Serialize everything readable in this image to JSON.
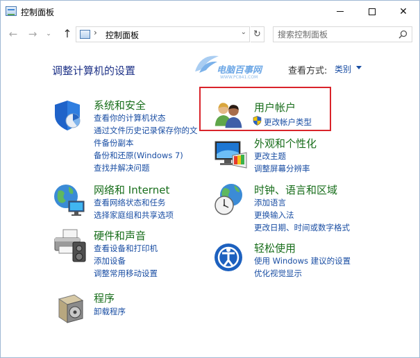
{
  "window": {
    "title": "控制面板",
    "minimize_label": "",
    "maximize_label": "",
    "close_label": "✕"
  },
  "nav": {
    "back": "←",
    "forward": "→",
    "recent": "⌄",
    "up": "↑",
    "address_separator": "›",
    "address": "控制面板",
    "address_dropdown": "⌄",
    "refresh": "↻",
    "search_placeholder": "搜索控制面板"
  },
  "header": {
    "heading": "调整计算机的设置",
    "view_by_label": "查看方式:",
    "view_by_value": "类别"
  },
  "watermark": {
    "title": "电脑百事网",
    "url": "WWW.PC841.COM"
  },
  "categories": {
    "system": {
      "title": "系统和安全",
      "links": [
        "查看你的计算机状态",
        "通过文件历史记录保存你的文",
        "件备份副本",
        "备份和还原(Windows 7)",
        "查找并解决问题"
      ]
    },
    "network": {
      "title": "网络和 Internet",
      "links": [
        "查看网络状态和任务",
        "选择家庭组和共享选项"
      ]
    },
    "hardware": {
      "title": "硬件和声音",
      "links": [
        "查看设备和打印机",
        "添加设备",
        "调整常用移动设置"
      ]
    },
    "programs": {
      "title": "程序",
      "links": [
        "卸载程序"
      ]
    },
    "accounts": {
      "title": "用户帐户",
      "links": [
        "更改帐户类型"
      ]
    },
    "appearance": {
      "title": "外观和个性化",
      "links": [
        "更改主题",
        "调整屏幕分辨率"
      ]
    },
    "clock": {
      "title": "时钟、语言和区域",
      "links": [
        "添加语言",
        "更换输入法",
        "更改日期、时间或数字格式"
      ]
    },
    "ease": {
      "title": "轻松使用",
      "links": [
        "使用 Windows 建议的设置",
        "优化视觉显示"
      ]
    }
  },
  "colors": {
    "category_title": "#176d1a",
    "link": "#1a4ea3",
    "heading": "#1e3287",
    "highlight_box": "#d9232a"
  }
}
